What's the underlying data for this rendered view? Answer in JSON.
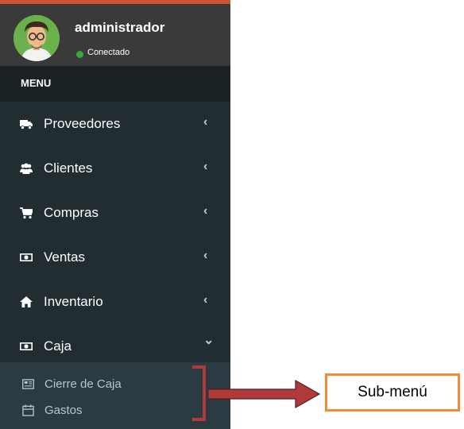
{
  "user": {
    "name": "administrador",
    "status": "Conectado"
  },
  "menu_header": "MENU",
  "menu_items": [
    {
      "label": "Proveedores",
      "icon": "truck-icon",
      "state": "collapsed",
      "chevron": "‹"
    },
    {
      "label": "Clientes",
      "icon": "users-icon",
      "state": "collapsed",
      "chevron": "‹"
    },
    {
      "label": "Compras",
      "icon": "cart-icon",
      "state": "collapsed",
      "chevron": "‹"
    },
    {
      "label": "Ventas",
      "icon": "money-icon",
      "state": "collapsed",
      "chevron": "‹"
    },
    {
      "label": "Inventario",
      "icon": "home-icon",
      "state": "collapsed",
      "chevron": "‹"
    },
    {
      "label": "Caja",
      "icon": "money-icon",
      "state": "expanded",
      "chevron": "⌄"
    }
  ],
  "submenu_items": [
    {
      "label": "Cierre de Caja",
      "icon": "register-icon"
    },
    {
      "label": "Gastos",
      "icon": "calendar-icon"
    }
  ],
  "annotation": {
    "label": "Sub-menú"
  },
  "colors": {
    "sidebar_bg": "#222d32",
    "user_panel_bg": "#3a3a3a",
    "submenu_bg": "#2c3b41",
    "accent_top": "#c9542f",
    "status_green": "#3aa640",
    "annotation_orange": "#f08e35",
    "annotation_red": "#b03a3a"
  }
}
